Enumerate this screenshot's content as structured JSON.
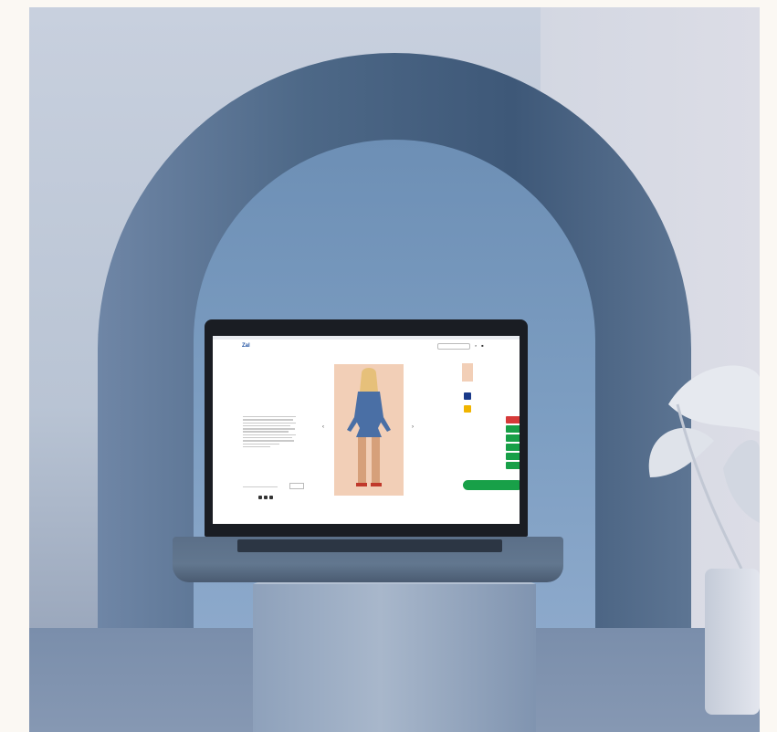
{
  "scene": {
    "colors": {
      "arch": "#4d6887",
      "arch_inner": "#7d9ec2",
      "wall": "#c8d0de",
      "floor": "#7a8eab"
    }
  },
  "site": {
    "browser_bar": [
      "",
      "",
      ""
    ],
    "logo": {
      "text": "Zal",
      "badge": ""
    },
    "nav_links": [
      "",
      "",
      ""
    ],
    "icons": [
      "search-icon",
      "bag-icon"
    ],
    "breadcrumb": "",
    "product": {
      "title": "",
      "reference": "",
      "price": "",
      "installments": "",
      "description_title": "",
      "composition_title": "",
      "composition_value": "",
      "shipping_title": "",
      "shipping_button": "",
      "share_label": ""
    },
    "buy_button": "",
    "colors": {
      "brand": "#1c4fa0",
      "accent_green": "#18a048",
      "accent_red": "#d63a3a",
      "swatch_navy": "#1a3a8a",
      "swatch_yellow": "#f0b400"
    }
  }
}
